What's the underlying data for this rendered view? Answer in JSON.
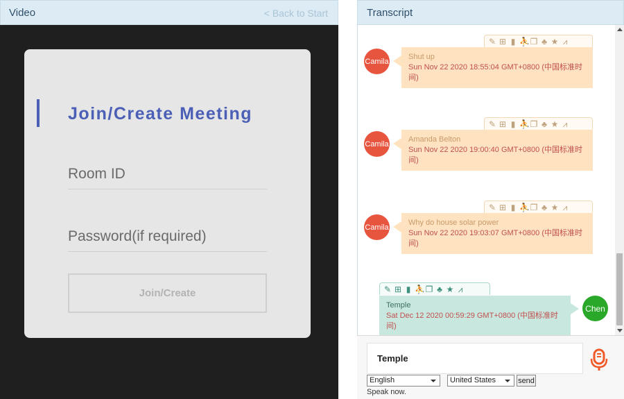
{
  "video": {
    "title": "Video",
    "back_link": "< Back to Start",
    "join_title": "Join/Create Meeting",
    "room_placeholder": "Room ID",
    "password_placeholder": "Password(if required)",
    "join_button": "Join/Create"
  },
  "transcript": {
    "title": "Transcript",
    "messages": [
      {
        "avatar": "Camila",
        "speaker_text": "Shut up",
        "timestamp": "Sun Nov 22 2020 18:55:04 GMT+0800 (中国标准时间)"
      },
      {
        "avatar": "Camila",
        "speaker_text": "Amanda Belton",
        "timestamp": "Sun Nov 22 2020 19:00:40 GMT+0800 (中国标准时间)"
      },
      {
        "avatar": "Camila",
        "speaker_text": "Why do house solar power",
        "timestamp": "Sun Nov 22 2020 19:03:07 GMT+0800 (中国标准时间)"
      },
      {
        "avatar": "Chen",
        "speaker_text": "Temple",
        "timestamp": "Sat Dec 12 2020 00:59:29 GMT+0800 (中国标准时间)"
      }
    ],
    "toolbar_icons": [
      "edit-icon",
      "grid-icon",
      "book-icon",
      "person-icon",
      "copy-icon",
      "group-icon",
      "star-icon",
      "chart-icon"
    ]
  },
  "input": {
    "message_value": "Temple",
    "language": "English",
    "region": "United States",
    "send_label": "send",
    "status": "Speak now."
  },
  "colors": {
    "header_bg": "#dcebf4",
    "accent": "#4b5fb6",
    "other_bubble": "#ffe2bf",
    "self_bubble": "#c8e7df",
    "other_avatar": "#e8553f",
    "self_avatar": "#2aa82a",
    "mic": "#f05a28"
  }
}
